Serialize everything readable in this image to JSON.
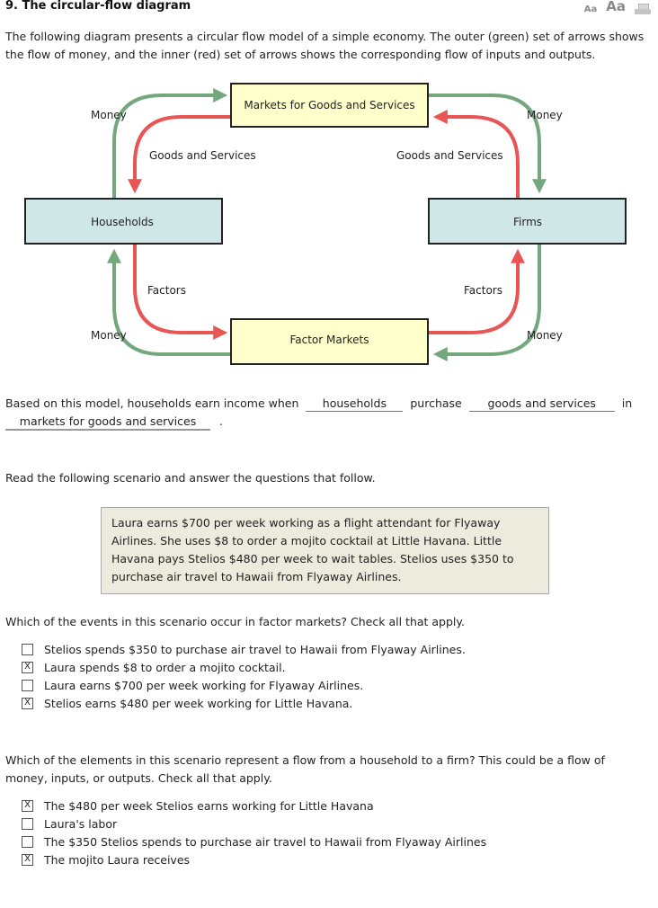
{
  "header": {
    "title": "9.  The circular-flow diagram",
    "font_small_label": "Aa",
    "font_large_label": "Aa",
    "print_icon": "printer-icon"
  },
  "intro": "The following diagram presents a circular flow model of a simple economy. The outer (green) set of arrows shows the flow of money, and the inner (red) set of arrows shows the corresponding flow of inputs and outputs.",
  "diagram": {
    "colors": {
      "money_arrow": "#74a77e",
      "goods_arrow": "#e85555",
      "market_box_fill": "#ffffcc",
      "agent_box_fill": "#cfe7e7",
      "box_border": "#222222"
    },
    "boxes": {
      "goods_market": "Markets for Goods and Services",
      "factor_market": "Factor Markets",
      "households": "Households",
      "firms": "Firms"
    },
    "labels": {
      "money_top_left": "Money",
      "money_top_right": "Money",
      "money_bottom_left": "Money",
      "money_bottom_right": "Money",
      "goods_left": "Goods and Services",
      "goods_right": "Goods and Services",
      "factors_left": "Factors",
      "factors_right": "Factors"
    }
  },
  "fill_in": {
    "prefix": "Based on this model, households earn income when",
    "blank1": "households",
    "middle": "purchase",
    "blank2": "goods and services",
    "suffix": "in",
    "blank3": "markets for goods and services",
    "end": "."
  },
  "scenario_intro": "Read the following scenario and answer the questions that follow.",
  "scenario_text": "Laura earns $700 per week working as a flight attendant for Flyaway Airlines. She uses $8 to order a mojito cocktail at Little Havana. Little Havana pays Stelios $480 per week to wait tables. Stelios uses $350 to purchase air travel to Hawaii from Flyaway Airlines.",
  "question1": {
    "prompt": "Which of the events in this scenario occur in factor markets? Check all that apply.",
    "options": [
      {
        "label": "Stelios spends $350 to purchase air travel to Hawaii from Flyaway Airlines.",
        "checked": false,
        "mark": ""
      },
      {
        "label": "Laura spends $8 to order a mojito cocktail.",
        "checked": true,
        "mark": "X"
      },
      {
        "label": "Laura earns $700 per week working for Flyaway Airlines.",
        "checked": false,
        "mark": ""
      },
      {
        "label": "Stelios earns $480 per week working for Little Havana.",
        "checked": true,
        "mark": "X"
      }
    ]
  },
  "question2": {
    "prompt": "Which of the elements in this scenario represent a flow from a household to a firm? This could be a flow of money, inputs, or outputs. Check all that apply.",
    "options": [
      {
        "label": "The $480 per week Stelios earns working for Little Havana",
        "checked": true,
        "mark": "X"
      },
      {
        "label": "Laura's labor",
        "checked": false,
        "mark": ""
      },
      {
        "label": "The $350 Stelios spends to purchase air travel to Hawaii from Flyaway Airlines",
        "checked": false,
        "mark": ""
      },
      {
        "label": "The mojito Laura receives",
        "checked": true,
        "mark": "X"
      }
    ]
  }
}
